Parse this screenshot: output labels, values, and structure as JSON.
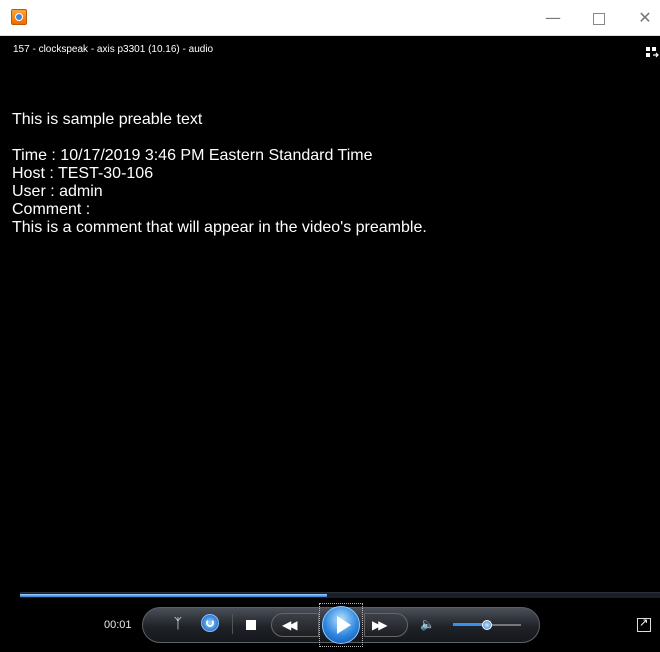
{
  "window": {
    "minimize_glyph": "—",
    "close_glyph": "✕"
  },
  "media": {
    "title": "157 - clockspeak - axis p3301 (10.16) - audio"
  },
  "preamble": {
    "heading": "This is sample preable text",
    "time_line": "Time : 10/17/2019 3:46 PM Eastern Standard Time",
    "host_line": "Host : TEST-30-106",
    "user_line": "User : admin",
    "comment_label": "Comment :",
    "comment_text": "This is a comment that will appear in the video's preamble."
  },
  "player": {
    "elapsed": "00:01",
    "progress": 0.48,
    "volume": 0.5,
    "icons": {
      "shuffle": "shuffle-icon",
      "repeat": "repeat-icon",
      "stop": "stop-icon",
      "previous": "rewind-icon",
      "play": "play-icon",
      "next": "fast-forward-icon",
      "volume": "speaker-icon",
      "fullscreen": "fullscreen-icon"
    },
    "glyphs": {
      "shuffle": "ᛉ",
      "previous": "◀◀",
      "next": "▶▶",
      "volume": "🔈"
    },
    "accent": "#2f86e0"
  }
}
